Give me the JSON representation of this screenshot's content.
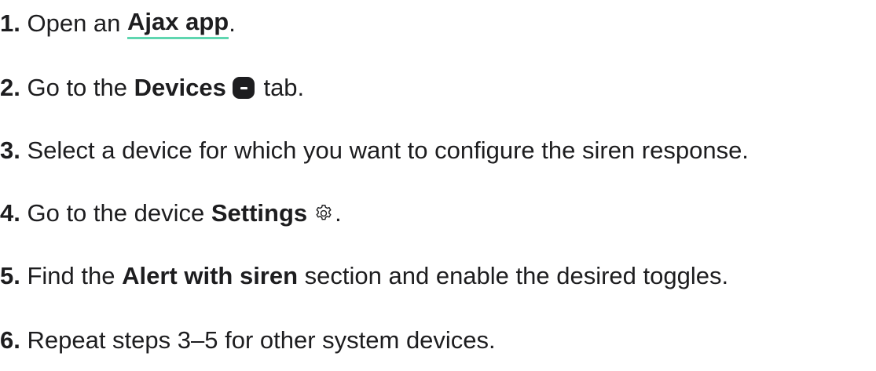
{
  "steps": [
    {
      "num": "1.",
      "pre": " Open an ",
      "link": "Ajax app",
      "post": "."
    },
    {
      "num": "2.",
      "pre": " Go to the ",
      "bold": "Devices",
      "post": " tab.",
      "icon": "devices-tab-icon"
    },
    {
      "num": "3.",
      "pre": " Select a device for which you want to configure the siren response."
    },
    {
      "num": "4.",
      "pre": " Go to the device ",
      "bold": "Settings",
      "post": ".",
      "icon": "gear-icon"
    },
    {
      "num": "5.",
      "pre": " Find the ",
      "bold": "Alert with siren",
      "post": " section and enable the desired toggles."
    },
    {
      "num": "6.",
      "pre": " Repeat steps 3–5 for other system devices."
    }
  ],
  "colors": {
    "text": "#1d1d1f",
    "link_underline": "#5fd6b0"
  }
}
